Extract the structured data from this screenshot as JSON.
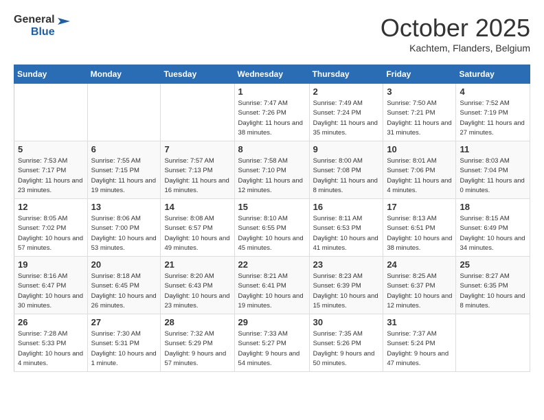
{
  "header": {
    "logo_line1": "General",
    "logo_line2": "Blue",
    "month": "October 2025",
    "location": "Kachtem, Flanders, Belgium"
  },
  "days_of_week": [
    "Sunday",
    "Monday",
    "Tuesday",
    "Wednesday",
    "Thursday",
    "Friday",
    "Saturday"
  ],
  "weeks": [
    [
      {
        "day": "",
        "info": ""
      },
      {
        "day": "",
        "info": ""
      },
      {
        "day": "",
        "info": ""
      },
      {
        "day": "1",
        "info": "Sunrise: 7:47 AM\nSunset: 7:26 PM\nDaylight: 11 hours and 38 minutes."
      },
      {
        "day": "2",
        "info": "Sunrise: 7:49 AM\nSunset: 7:24 PM\nDaylight: 11 hours and 35 minutes."
      },
      {
        "day": "3",
        "info": "Sunrise: 7:50 AM\nSunset: 7:21 PM\nDaylight: 11 hours and 31 minutes."
      },
      {
        "day": "4",
        "info": "Sunrise: 7:52 AM\nSunset: 7:19 PM\nDaylight: 11 hours and 27 minutes."
      }
    ],
    [
      {
        "day": "5",
        "info": "Sunrise: 7:53 AM\nSunset: 7:17 PM\nDaylight: 11 hours and 23 minutes."
      },
      {
        "day": "6",
        "info": "Sunrise: 7:55 AM\nSunset: 7:15 PM\nDaylight: 11 hours and 19 minutes."
      },
      {
        "day": "7",
        "info": "Sunrise: 7:57 AM\nSunset: 7:13 PM\nDaylight: 11 hours and 16 minutes."
      },
      {
        "day": "8",
        "info": "Sunrise: 7:58 AM\nSunset: 7:10 PM\nDaylight: 11 hours and 12 minutes."
      },
      {
        "day": "9",
        "info": "Sunrise: 8:00 AM\nSunset: 7:08 PM\nDaylight: 11 hours and 8 minutes."
      },
      {
        "day": "10",
        "info": "Sunrise: 8:01 AM\nSunset: 7:06 PM\nDaylight: 11 hours and 4 minutes."
      },
      {
        "day": "11",
        "info": "Sunrise: 8:03 AM\nSunset: 7:04 PM\nDaylight: 11 hours and 0 minutes."
      }
    ],
    [
      {
        "day": "12",
        "info": "Sunrise: 8:05 AM\nSunset: 7:02 PM\nDaylight: 10 hours and 57 minutes."
      },
      {
        "day": "13",
        "info": "Sunrise: 8:06 AM\nSunset: 7:00 PM\nDaylight: 10 hours and 53 minutes."
      },
      {
        "day": "14",
        "info": "Sunrise: 8:08 AM\nSunset: 6:57 PM\nDaylight: 10 hours and 49 minutes."
      },
      {
        "day": "15",
        "info": "Sunrise: 8:10 AM\nSunset: 6:55 PM\nDaylight: 10 hours and 45 minutes."
      },
      {
        "day": "16",
        "info": "Sunrise: 8:11 AM\nSunset: 6:53 PM\nDaylight: 10 hours and 41 minutes."
      },
      {
        "day": "17",
        "info": "Sunrise: 8:13 AM\nSunset: 6:51 PM\nDaylight: 10 hours and 38 minutes."
      },
      {
        "day": "18",
        "info": "Sunrise: 8:15 AM\nSunset: 6:49 PM\nDaylight: 10 hours and 34 minutes."
      }
    ],
    [
      {
        "day": "19",
        "info": "Sunrise: 8:16 AM\nSunset: 6:47 PM\nDaylight: 10 hours and 30 minutes."
      },
      {
        "day": "20",
        "info": "Sunrise: 8:18 AM\nSunset: 6:45 PM\nDaylight: 10 hours and 26 minutes."
      },
      {
        "day": "21",
        "info": "Sunrise: 8:20 AM\nSunset: 6:43 PM\nDaylight: 10 hours and 23 minutes."
      },
      {
        "day": "22",
        "info": "Sunrise: 8:21 AM\nSunset: 6:41 PM\nDaylight: 10 hours and 19 minutes."
      },
      {
        "day": "23",
        "info": "Sunrise: 8:23 AM\nSunset: 6:39 PM\nDaylight: 10 hours and 15 minutes."
      },
      {
        "day": "24",
        "info": "Sunrise: 8:25 AM\nSunset: 6:37 PM\nDaylight: 10 hours and 12 minutes."
      },
      {
        "day": "25",
        "info": "Sunrise: 8:27 AM\nSunset: 6:35 PM\nDaylight: 10 hours and 8 minutes."
      }
    ],
    [
      {
        "day": "26",
        "info": "Sunrise: 7:28 AM\nSunset: 5:33 PM\nDaylight: 10 hours and 4 minutes."
      },
      {
        "day": "27",
        "info": "Sunrise: 7:30 AM\nSunset: 5:31 PM\nDaylight: 10 hours and 1 minute."
      },
      {
        "day": "28",
        "info": "Sunrise: 7:32 AM\nSunset: 5:29 PM\nDaylight: 9 hours and 57 minutes."
      },
      {
        "day": "29",
        "info": "Sunrise: 7:33 AM\nSunset: 5:27 PM\nDaylight: 9 hours and 54 minutes."
      },
      {
        "day": "30",
        "info": "Sunrise: 7:35 AM\nSunset: 5:26 PM\nDaylight: 9 hours and 50 minutes."
      },
      {
        "day": "31",
        "info": "Sunrise: 7:37 AM\nSunset: 5:24 PM\nDaylight: 9 hours and 47 minutes."
      },
      {
        "day": "",
        "info": ""
      }
    ]
  ]
}
